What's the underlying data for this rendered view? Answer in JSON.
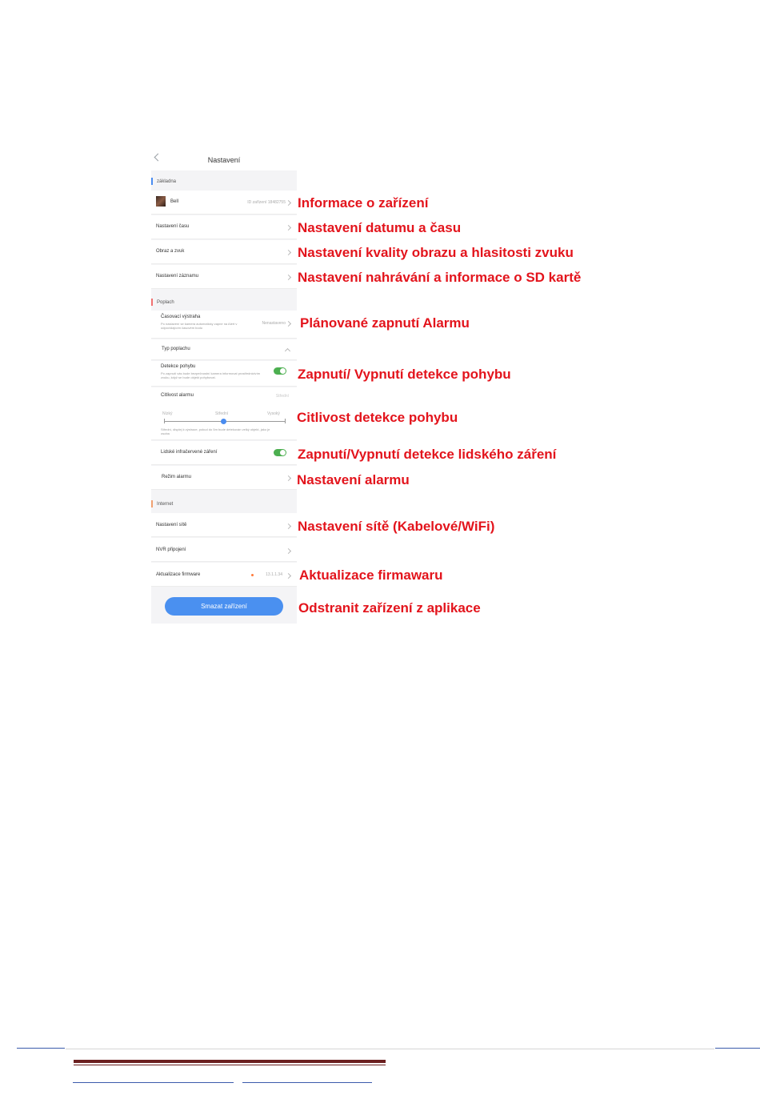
{
  "app": {
    "header": {
      "title": "Nastavení"
    },
    "sections": {
      "basic": "základna",
      "alarm": "Poplach",
      "internet": "Internet"
    },
    "rows": {
      "device": {
        "name": "Bell",
        "id": "ID zařízení 18482755"
      },
      "time": "Nastavení času",
      "image_sound": "Obraz a zvuk",
      "record": "Nastavení záznamu",
      "timed_alert": {
        "label": "Časovací výstraha",
        "description": "Po nastavení se kamera automaticky zapne na Alert v odpovídajícím časovém bodu",
        "value": "Nenastaveno"
      },
      "alarm_type": "Typ poplachu",
      "motion": {
        "label": "Detekce pohybu",
        "description": "Po zapnutí vás bude bezpečnostní kamera informovat prostřednictvím zvuku, když se bude objekt pohybovat."
      },
      "sensitivity": {
        "label": "Citlivost alarmu",
        "value": "Střední",
        "low": "Nízký",
        "mid": "Střední",
        "high": "Vysoký",
        "description": "Střední, displej k výstraze, pokud do 5m bude detekován velký objekt, jako je osoba"
      },
      "infrared": "Lidské infračervené záření",
      "alarm_mode": "Režim alarmu",
      "network": "Nastavení sítě",
      "nvr": "NVR připojení",
      "firmware": {
        "label": "Aktualizace firmware",
        "version": "13.1.1.34"
      }
    },
    "delete_button": "Smazat zařízení"
  },
  "annotations": {
    "device_info": "Informace o zařízení",
    "date_time": "Nastavení datumu a času",
    "image_sound": "Nastavení kvality obrazu a hlasitosti zvuku",
    "recording": "Nastavení nahrávání a informace o SD kartě",
    "alarm_schedule": "Plánované zapnutí Alarmu",
    "motion": "Zapnutí/ Vypnutí detekce pohybu",
    "sensitivity": "Citlivost detekce pohybu",
    "human_radiation": "Zapnutí/Vypnutí detekce lidského záření",
    "alarm_settings": "Nastavení alarmu",
    "network": "Nastavení sítě (Kabelové/WiFi)",
    "firmware": "Aktualizace firmawaru",
    "remove_device": "Odstranit zařízení z aplikace"
  },
  "colors": {
    "annotation": "#e3141c",
    "toggle_on": "#4caf50",
    "button": "#4a90f0",
    "basic_bar": "#4a8cf0",
    "alarm_bar": "#f07070",
    "internet_bar": "#f0a070"
  }
}
